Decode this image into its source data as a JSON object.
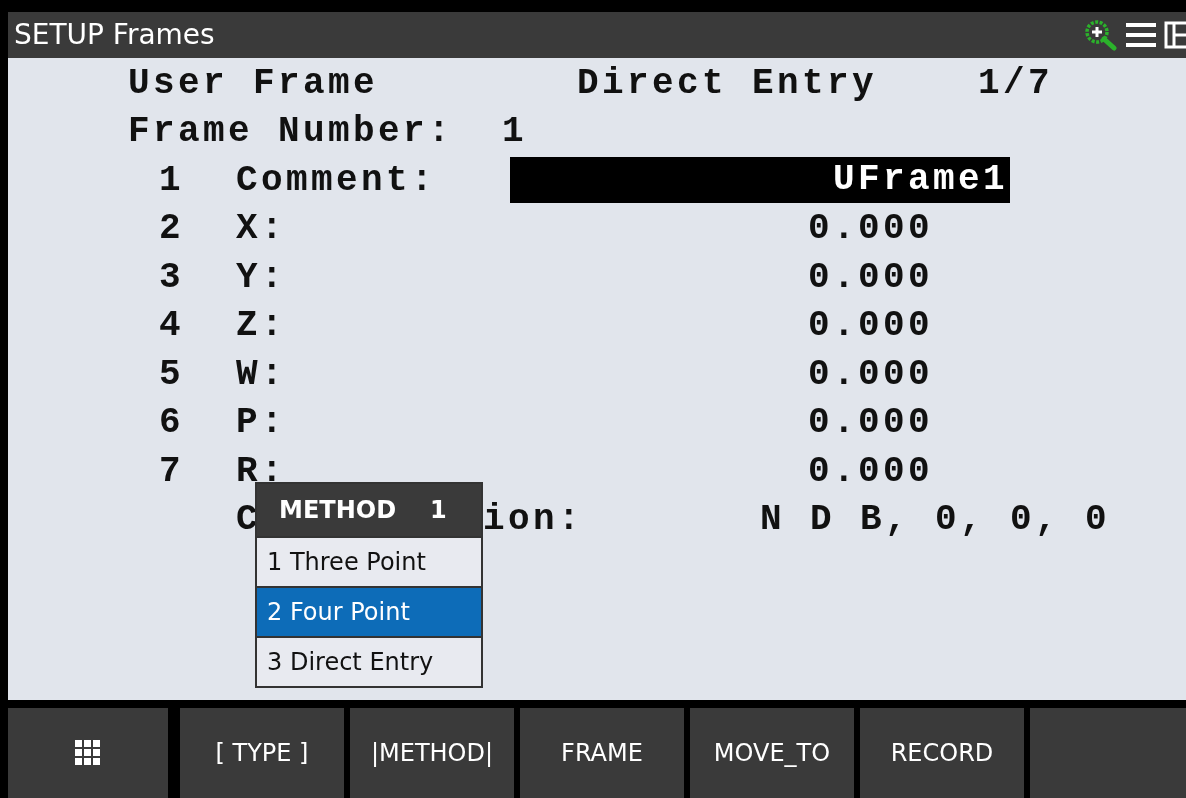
{
  "window": {
    "title": "SETUP Frames"
  },
  "header": {
    "frame_type": "User Frame",
    "method": "Direct Entry",
    "page": "1/7",
    "frame_number_label": "Frame Number:",
    "frame_number": "1"
  },
  "rows": [
    {
      "number": "1",
      "label": "Comment:",
      "value": "UFrame1",
      "selected": true
    },
    {
      "number": "2",
      "label": "X:",
      "value": "0.000",
      "selected": false
    },
    {
      "number": "3",
      "label": "Y:",
      "value": "0.000",
      "selected": false
    },
    {
      "number": "4",
      "label": "Z:",
      "value": "0.000",
      "selected": false
    },
    {
      "number": "5",
      "label": "W:",
      "value": "0.000",
      "selected": false
    },
    {
      "number": "6",
      "label": "P:",
      "value": "0.000",
      "selected": false
    },
    {
      "number": "7",
      "label": "R:",
      "value": "0.000",
      "selected": false
    }
  ],
  "partial_row": {
    "label_start": "C",
    "label_end": "ion:",
    "value": "N D B, 0, 0, 0"
  },
  "popup": {
    "title": "METHOD",
    "number": "1",
    "items": [
      {
        "label": "1 Three Point",
        "selected": false
      },
      {
        "label": "2 Four Point",
        "selected": true
      },
      {
        "label": "3 Direct Entry",
        "selected": false
      }
    ]
  },
  "softkeys": [
    {
      "kind": "menu"
    },
    {
      "kind": "label",
      "label": "[ TYPE ]"
    },
    {
      "kind": "label",
      "label": "|METHOD|"
    },
    {
      "kind": "label",
      "label": "FRAME"
    },
    {
      "kind": "label",
      "label": "MOVE_TO"
    },
    {
      "kind": "label",
      "label": "RECORD"
    },
    {
      "kind": "empty"
    }
  ]
}
